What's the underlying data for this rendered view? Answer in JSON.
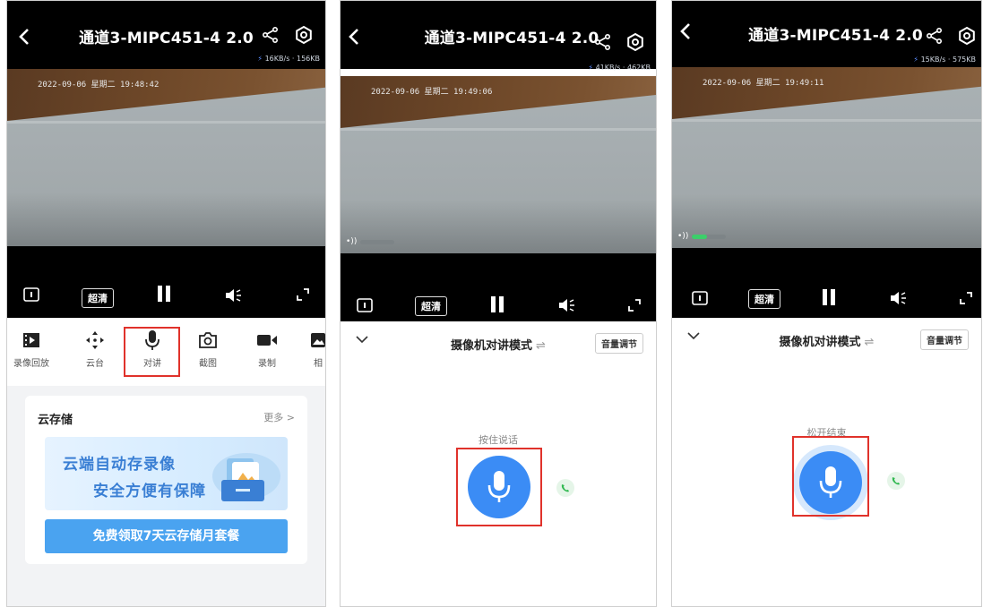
{
  "title": "通道3-MIPC451-4 2.0",
  "quality_label": "超清",
  "screens": [
    {
      "speed": "16KB/s · 156KB",
      "osd": "2022-09-06 星期二 19:48:42"
    },
    {
      "speed": "41KB/s · 462KB",
      "osd": "2022-09-06 星期二 19:49:06",
      "talk_level": 0
    },
    {
      "speed": "15KB/s · 575KB",
      "osd": "2022-09-06 星期二 19:49:11",
      "talk_level": 0.45
    }
  ],
  "tools": [
    {
      "label": "录像回放",
      "icon": "playback-icon"
    },
    {
      "label": "云台",
      "icon": "ptz-icon"
    },
    {
      "label": "对讲",
      "icon": "mic-icon"
    },
    {
      "label": "截图",
      "icon": "camera-icon"
    },
    {
      "label": "录制",
      "icon": "record-icon"
    },
    {
      "label": "相",
      "icon": "album-icon"
    }
  ],
  "cloud": {
    "heading": "云存储",
    "more": "更多 >",
    "line1": "云端自动存录像",
    "line2": "安全方便有保障",
    "cta": "免费领取7天云存储月套餐"
  },
  "talk": {
    "mode": "摄像机对讲模式",
    "switch_glyph": "⇌",
    "volume": "音量调节",
    "hold_hint": "按住说话",
    "release_hint": "松开结束"
  },
  "colors": {
    "accent": "#3b8cf5",
    "highlight": "#e0322b",
    "talk_level": "#3ccf6a"
  }
}
